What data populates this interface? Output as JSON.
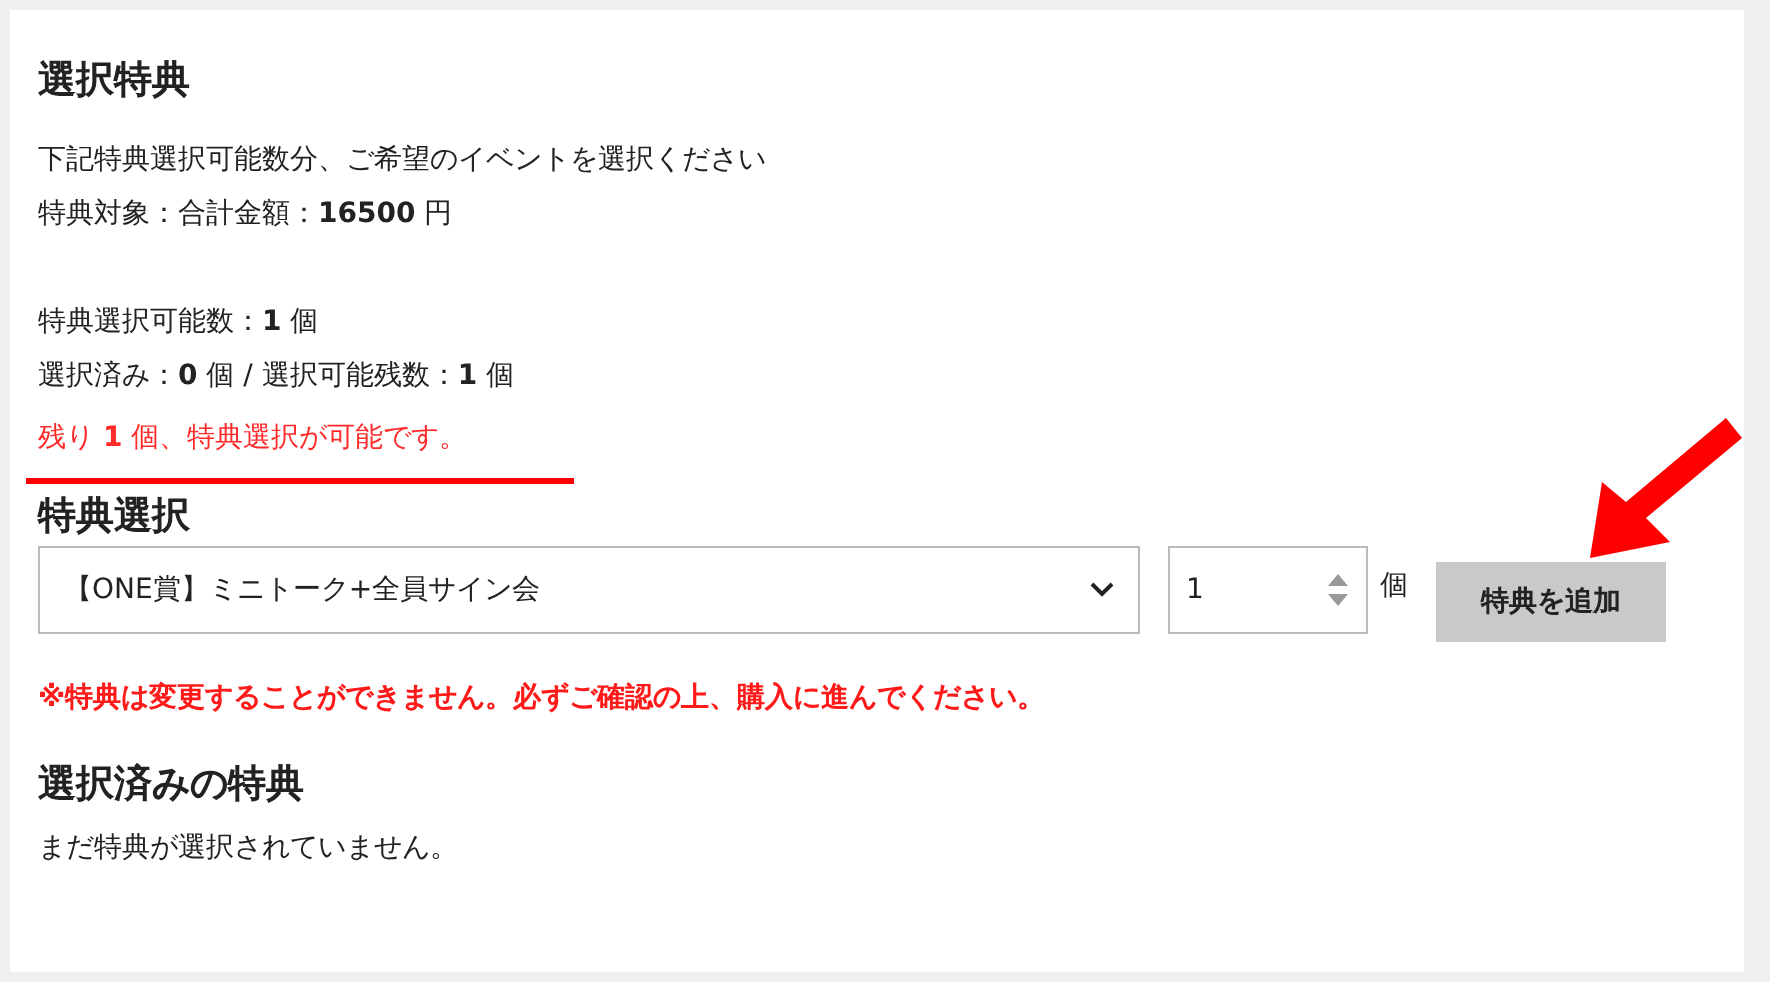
{
  "title": "選択特典",
  "intro": [
    "下記特典選択可能数分、ご希望のイベントを選択ください",
    "特典対象：合計金額：**16500** 円"
  ],
  "counts": [
    "特典選択可能数：**1** 個",
    "選択済み：**0** 個 / 選択可能残数：**1** 個"
  ],
  "remaining_notice": "残り **1** 個、特典選択が可能です。",
  "selection": {
    "heading": "特典選択",
    "select_value": "【ONE賞】ミニトーク+全員サイン会",
    "quantity": "1",
    "unit": "個",
    "add_button": "特典を追加"
  },
  "warning": "※特典は変更することができません。必ずご確認の上、購入に進んでください。",
  "selected": {
    "heading": "選択済みの特典",
    "empty_message": "まだ特典が選択されていません。"
  }
}
